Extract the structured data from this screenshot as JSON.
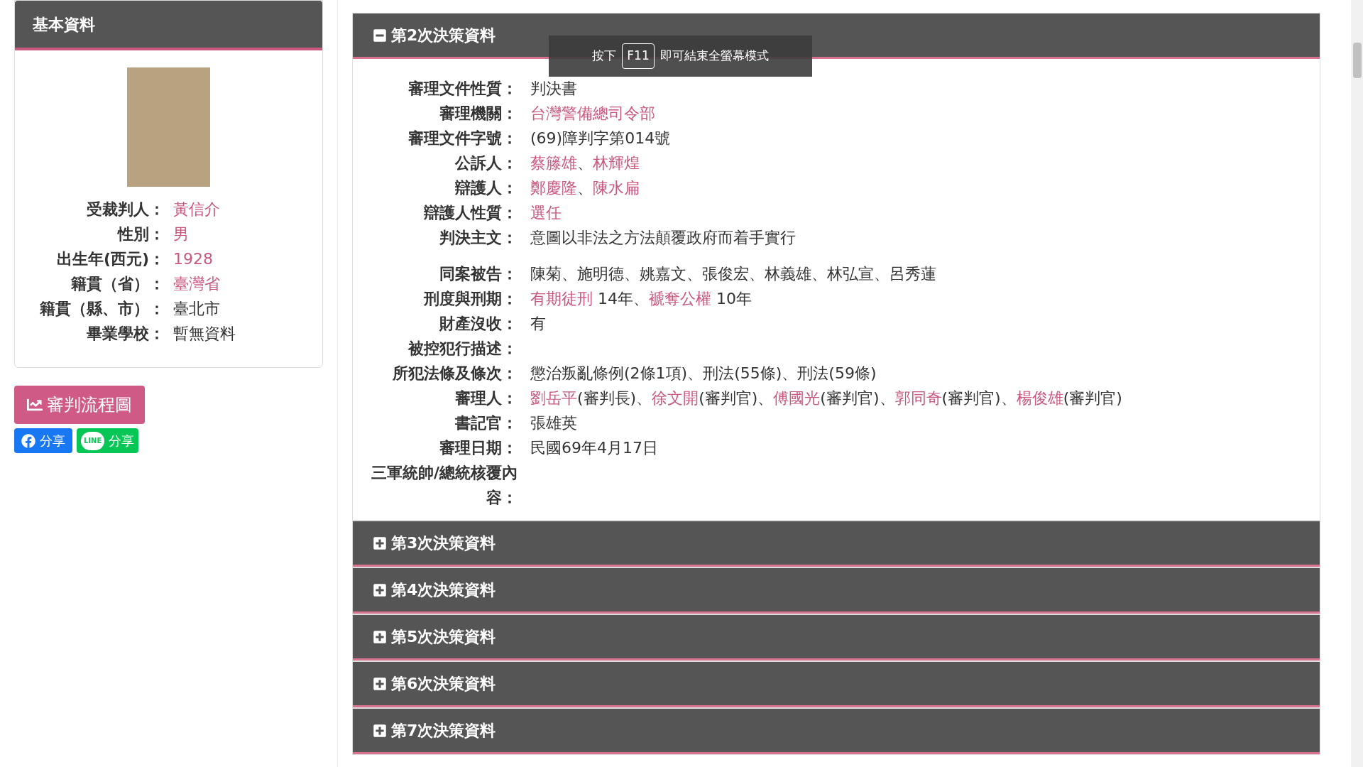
{
  "sidebar": {
    "title": "基本資料",
    "fields": [
      {
        "label": "受裁判人：",
        "value": [
          {
            "text": "黃信介",
            "link": true
          }
        ]
      },
      {
        "label": "性別：",
        "value": [
          {
            "text": "男",
            "link": true
          }
        ]
      },
      {
        "label": "出生年(西元)：",
        "value": [
          {
            "text": "1928",
            "link": true
          }
        ]
      },
      {
        "label": "籍貫（省）：",
        "value": [
          {
            "text": "臺灣省",
            "link": true
          }
        ]
      },
      {
        "label": "籍貫（縣、市）：",
        "value": [
          {
            "text": "臺北市",
            "link": false
          }
        ]
      },
      {
        "label": "畢業學校：",
        "value": [
          {
            "text": "暫無資料",
            "link": false
          }
        ]
      }
    ],
    "flow_button": "審判流程圖",
    "share_buttons": [
      {
        "kind": "facebook",
        "label": "分享"
      },
      {
        "kind": "line",
        "label": "分享",
        "logo_text": "LINE"
      }
    ]
  },
  "tooltip": {
    "before": "按下",
    "key": "F11",
    "after": "即可結束全螢幕模式"
  },
  "sections": [
    {
      "title": "第2次決策資料",
      "expanded": true,
      "field_groups": [
        [
          {
            "label": "審理文件性質：",
            "value": [
              {
                "text": "判決書",
                "link": false
              }
            ]
          },
          {
            "label": "審理機關：",
            "value": [
              {
                "text": "台灣警備總司令部",
                "link": true
              }
            ]
          },
          {
            "label": "審理文件字號：",
            "value": [
              {
                "text": "(69)障判字第014號",
                "link": false
              }
            ]
          },
          {
            "label": "公訴人：",
            "value": [
              {
                "text": "蔡籐雄",
                "link": true
              },
              {
                "text": "、",
                "link": false
              },
              {
                "text": "林輝煌",
                "link": true
              }
            ]
          },
          {
            "label": "辯護人：",
            "value": [
              {
                "text": "鄭慶隆",
                "link": true
              },
              {
                "text": "、",
                "link": false
              },
              {
                "text": "陳水扁",
                "link": true
              }
            ]
          },
          {
            "label": "辯護人性質：",
            "value": [
              {
                "text": "選任",
                "link": true
              }
            ]
          },
          {
            "label": "判決主文：",
            "value": [
              {
                "text": "意圖以非法之方法顛覆政府而着手實行",
                "link": false
              }
            ]
          }
        ],
        [
          {
            "label": "同案被告：",
            "value": [
              {
                "text": "陳菊、施明德、姚嘉文、張俊宏、林義雄、林弘宣、呂秀蓮",
                "link": false
              }
            ]
          },
          {
            "label": "刑度與刑期：",
            "value": [
              {
                "text": "有期徒刑",
                "link": true
              },
              {
                "text": " 14年、",
                "link": false
              },
              {
                "text": "褫奪公權",
                "link": true
              },
              {
                "text": " 10年",
                "link": false
              }
            ]
          },
          {
            "label": "財產沒收：",
            "value": [
              {
                "text": "有",
                "link": false
              }
            ]
          },
          {
            "label": "被控犯行描述："
          },
          {
            "label": "所犯法條及條次：",
            "value": [
              {
                "text": "懲治叛亂條例(2條1項)、刑法(55條)、刑法(59條)",
                "link": false
              }
            ]
          },
          {
            "label": "審理人：",
            "value": [
              {
                "text": "劉岳平",
                "link": true
              },
              {
                "text": "(審判長)、",
                "link": false
              },
              {
                "text": "徐文開",
                "link": true
              },
              {
                "text": "(審判官)、",
                "link": false
              },
              {
                "text": "傅國光",
                "link": true
              },
              {
                "text": "(審判官)、",
                "link": false
              },
              {
                "text": "郭同奇",
                "link": true
              },
              {
                "text": "(審判官)、",
                "link": false
              },
              {
                "text": "楊俊雄",
                "link": true
              },
              {
                "text": "(審判官)",
                "link": false
              }
            ]
          },
          {
            "label": "書記官：",
            "value": [
              {
                "text": "張雄英",
                "link": false
              }
            ]
          },
          {
            "label": "審理日期：",
            "value": [
              {
                "text": "民國69年4月17日",
                "link": false
              }
            ]
          },
          {
            "label": "三軍統帥/總統核覆內容："
          }
        ]
      ]
    },
    {
      "title": "第3次決策資料",
      "expanded": false
    },
    {
      "title": "第4次決策資料",
      "expanded": false
    },
    {
      "title": "第5次決策資料",
      "expanded": false
    },
    {
      "title": "第6次決策資料",
      "expanded": false
    },
    {
      "title": "第7次決策資料",
      "expanded": false
    }
  ]
}
